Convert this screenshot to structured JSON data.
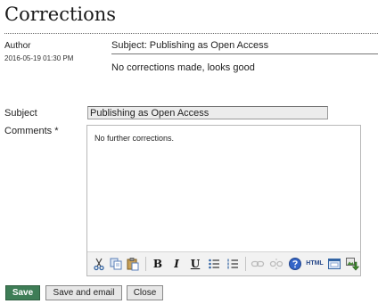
{
  "page": {
    "title": "Corrections"
  },
  "comment": {
    "author_label": "Author",
    "date": "2016-05-19 01:30 PM",
    "subject_text": "Subject: Publishing as Open Access",
    "body": "No corrections made, looks good"
  },
  "form": {
    "subject_label": "Subject",
    "subject_value": "Publishing as Open Access",
    "comments_label": "Comments *",
    "comments_value": "No further corrections."
  },
  "toolbar": {
    "icons": [
      "cut-icon",
      "copy-icon",
      "paste-icon",
      "bold-icon",
      "italic-icon",
      "underline-icon",
      "bullet-list-icon",
      "numbered-list-icon",
      "link-icon",
      "unlink-icon",
      "help-icon",
      "html-icon",
      "fullscreen-icon",
      "insert-image-icon"
    ],
    "bold_glyph": "B",
    "italic_glyph": "I",
    "underline_glyph": "U",
    "html_label": "HTML"
  },
  "actions": {
    "save_label": "Save",
    "save_email_label": "Save and email",
    "close_label": "Close"
  },
  "colors": {
    "save_button": "#3e7d56",
    "help_icon": "#3465c8"
  }
}
